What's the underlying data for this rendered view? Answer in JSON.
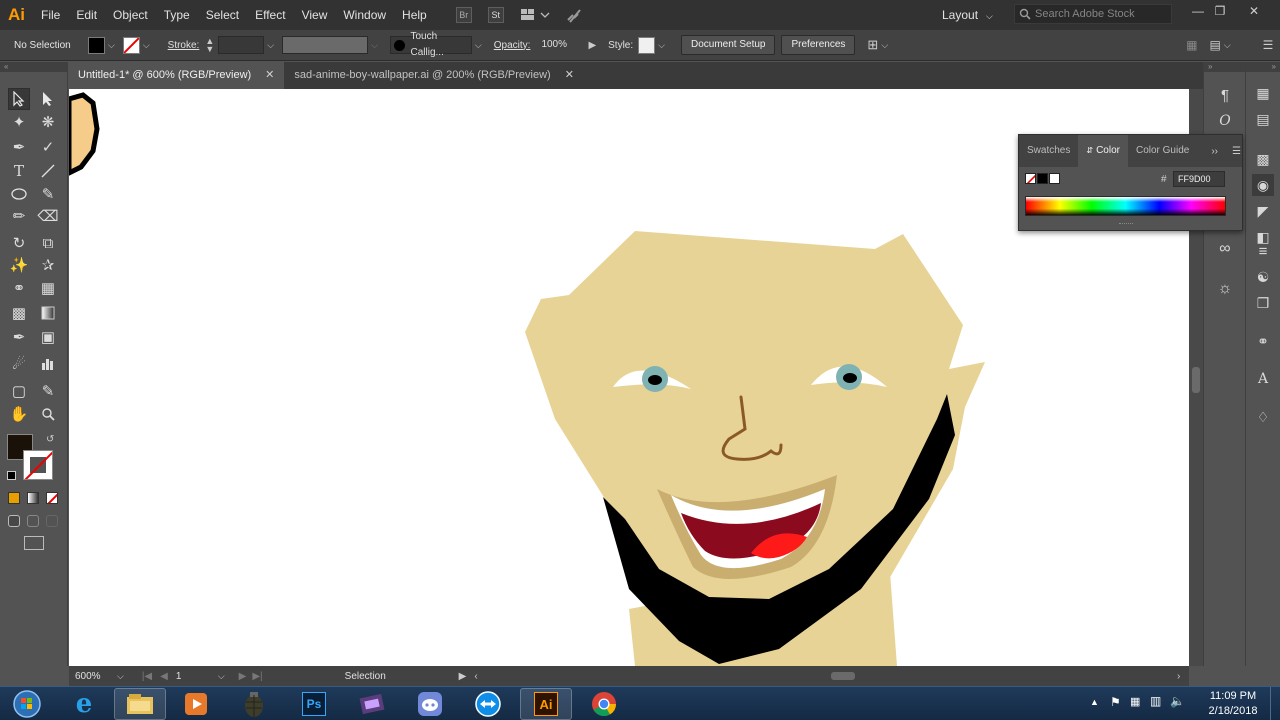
{
  "app": {
    "logo_text": "Ai",
    "accent": "#ff9a00"
  },
  "menu": {
    "items": [
      "File",
      "Edit",
      "Object",
      "Type",
      "Select",
      "Effect",
      "View",
      "Window",
      "Help"
    ],
    "bridge_icon": "Br",
    "stock_icon": "St",
    "workspace_label": "Layout",
    "search_placeholder": "Search Adobe Stock"
  },
  "control_bar": {
    "selection_label": "No Selection",
    "stroke_label": "Stroke:",
    "brush_label": "Touch Callig...",
    "opacity_label": "Opacity:",
    "opacity_value": "100%",
    "style_label": "Style:",
    "document_setup": "Document Setup",
    "preferences": "Preferences"
  },
  "tabs": [
    {
      "label": "Untitled-1* @ 600% (RGB/Preview)",
      "active": true
    },
    {
      "label": "sad-anime-boy-wallpaper.ai @ 200% (RGB/Preview)",
      "active": false
    }
  ],
  "status": {
    "zoom": "600%",
    "artboard": "1",
    "tool": "Selection"
  },
  "color_panel": {
    "tabs": [
      "Swatches",
      "Color",
      "Color Guide"
    ],
    "active_tab": "Color",
    "hex_symbol": "#",
    "hex_value": "FF9D00"
  },
  "artwork_colors": {
    "skin": "#e8d396",
    "beard": "#000000",
    "eye_white": "#ffffff",
    "iris": "#7fb2b3",
    "pupil": "#000000",
    "nose": "#8b5a24",
    "lip": "#c9ae70",
    "mouth": "#8c0a1e",
    "tongue": "#ff1a1a"
  },
  "taskbar": {
    "time": "11:09 PM",
    "date": "2/18/2018",
    "apps": [
      "start-icon",
      "ie-icon",
      "explorer-icon",
      "media-player-icon",
      "grenade-icon",
      "photoshop-icon",
      "video-editor-icon",
      "discord-icon",
      "teamviewer-icon",
      "illustrator-icon",
      "chrome-icon"
    ],
    "ps_label": "Ps",
    "ai_label": "Ai"
  }
}
